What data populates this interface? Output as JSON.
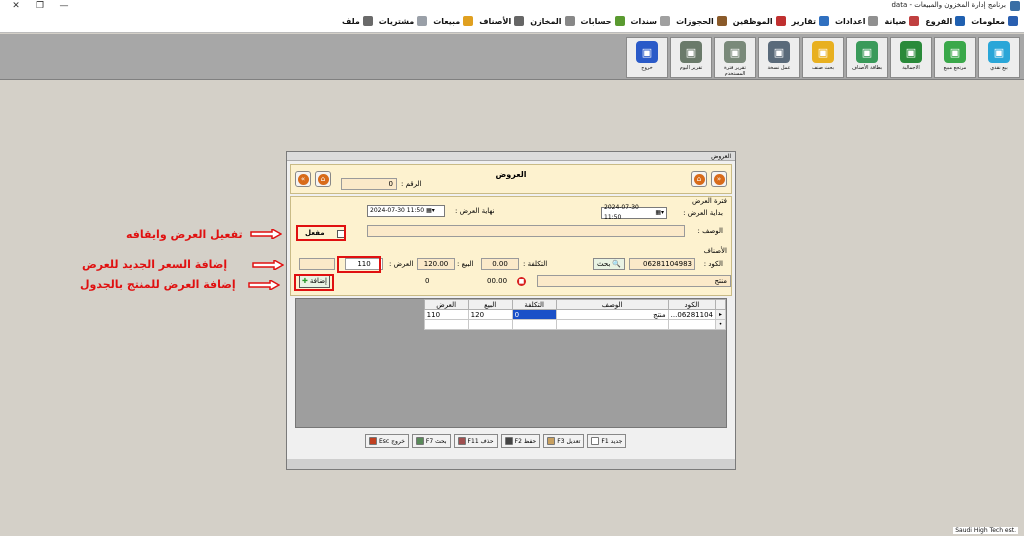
{
  "window": {
    "title": "برنامج إدارة المخزون والمبيعات - data",
    "controls": [
      "✕",
      "❐",
      "—"
    ]
  },
  "menu": [
    {
      "label": "ملف",
      "icon": "file-icon",
      "color": "#6a6a6a"
    },
    {
      "label": "مشتريات",
      "icon": "document-icon",
      "color": "#9aa0a8"
    },
    {
      "label": "مبيعات",
      "icon": "bag-icon",
      "color": "#e0a020"
    },
    {
      "label": "الأصناف",
      "icon": "box-icon",
      "color": "#666666"
    },
    {
      "label": "المخازن",
      "icon": "warehouse-icon",
      "color": "#888888"
    },
    {
      "label": "حسابات",
      "icon": "calculator-icon",
      "color": "#5a9a30"
    },
    {
      "label": "سندات",
      "icon": "receipt-icon",
      "color": "#a0a0a0"
    },
    {
      "label": "الحجوزات",
      "icon": "clipboard-icon",
      "color": "#8a5a2a"
    },
    {
      "label": "الموظفين",
      "icon": "employee-icon",
      "color": "#c03030"
    },
    {
      "label": "تقارير",
      "icon": "report-icon",
      "color": "#3070c0"
    },
    {
      "label": "اعدادات",
      "icon": "settings-icon",
      "color": "#909090"
    },
    {
      "label": "صيانة",
      "icon": "wrench-icon",
      "color": "#c04040"
    },
    {
      "label": "الفروع",
      "icon": "branches-icon",
      "color": "#2060b0"
    },
    {
      "label": "معلومات",
      "icon": "info-icon",
      "color": "#2a5fb0"
    }
  ],
  "toolbar": [
    {
      "label": "بيع نقدي",
      "icon": "cash-sale-icon",
      "color": "#2aa6d8"
    },
    {
      "label": "مرتجع مبيع",
      "icon": "sales-return-icon",
      "color": "#3aa84a"
    },
    {
      "label": "الاجمالية",
      "icon": "total-icon",
      "color": "#2a8a3a"
    },
    {
      "label": "بطاقة الأصناف",
      "icon": "item-card-icon",
      "color": "#3a9a5a"
    },
    {
      "label": "بحث صنف",
      "icon": "search-item-icon",
      "color": "#e8b020"
    },
    {
      "label": "عمل نسخة",
      "icon": "backup-icon",
      "color": "#5a6a7a"
    },
    {
      "label": "تقرير فترة المستخدم",
      "icon": "user-period-report-icon",
      "color": "#7a8a7a"
    },
    {
      "label": "تقرير اليوم",
      "icon": "daily-report-icon",
      "color": "#6a7a6a"
    },
    {
      "label": "خروج",
      "icon": "lock-icon",
      "color": "#2a5ac8"
    }
  ],
  "status": {
    "company": "Saudi High Tech est."
  },
  "dialog": {
    "window_title": "العروض",
    "heading": "العروض",
    "number_label": "الرقم :",
    "number_value": "0",
    "period_title": "فترة العرض",
    "start_label": "بداية العرض :",
    "start_value": "2024-07-30 11:50",
    "end_label": "نهاية العرض :",
    "end_value": "2024-07-30 11:50",
    "description_label": "الوصف :",
    "description_value": "",
    "active_label": "مفعل",
    "items_title": "الأصناف",
    "code_label": "الكود :",
    "code_value": "06281104983",
    "search_label": "بحث",
    "cost_label": "التكلفة :",
    "cost_value": "0.00",
    "price_label": "البيع :",
    "price_value": "120.00",
    "offer_label": "العرض :",
    "offer_value": "110",
    "product_name": "منتج",
    "total_value": "00.00",
    "count_value": "0",
    "add_label": "إضافة",
    "grid": {
      "headers": [
        "الكود",
        "الوصف",
        "التكلفة",
        "البيع",
        "العرض"
      ],
      "rows": [
        {
          "code": "06281104...",
          "desc": "منتج",
          "cost": "0",
          "price": "120",
          "offer": "110"
        }
      ]
    },
    "footer_buttons": [
      {
        "label": "جديد F1",
        "icon": "new-icon",
        "color": "#ffffff"
      },
      {
        "label": "تعديل F3",
        "icon": "edit-icon",
        "color": "#c8a060"
      },
      {
        "label": "حفظ F2",
        "icon": "save-icon",
        "color": "#444444"
      },
      {
        "label": "حذف F11",
        "icon": "delete-icon",
        "color": "#a05050"
      },
      {
        "label": "بحث F7",
        "icon": "search-icon",
        "color": "#5a8a5a"
      },
      {
        "label": "خروج Esc",
        "icon": "exit-icon",
        "color": "#c04020"
      }
    ]
  },
  "annotations": {
    "toggle": "تفعيل العرض وايقافه",
    "new_price": "إضافة السعر الجديد للعرض",
    "add_to_table": "إضافة العرض للمنتج بالجدول"
  }
}
